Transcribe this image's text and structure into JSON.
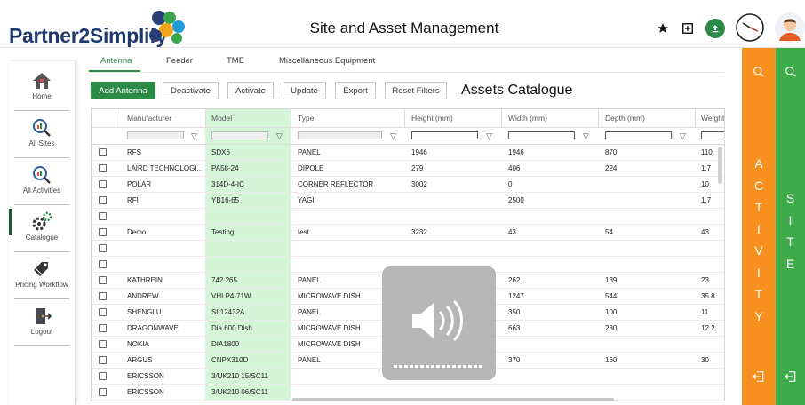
{
  "app": {
    "logo_text": "Partner2Simplify",
    "title": "Site and Asset Management"
  },
  "header_icons": [
    "star-icon",
    "add-box-icon",
    "upload-icon",
    "clock-icon",
    "user-avatar"
  ],
  "colors": {
    "primary_green": "#2b8a46",
    "activity_orange": "#f7901e",
    "site_green": "#3dab4a",
    "model_column_bg": "#d5f5d8"
  },
  "sidebar": {
    "items": [
      {
        "label": "Home",
        "icon": "home-icon"
      },
      {
        "label": "All Sites",
        "icon": "sites-search-icon"
      },
      {
        "label": "All Activities",
        "icon": "activities-search-icon"
      },
      {
        "label": "Catalogue",
        "icon": "gears-icon",
        "active": true
      },
      {
        "label": "Pricing Workflow",
        "icon": "price-tags-icon"
      },
      {
        "label": "Logout",
        "icon": "logout-door-icon"
      }
    ]
  },
  "tabs": [
    {
      "label": "Antenna",
      "active": true
    },
    {
      "label": "Feeder"
    },
    {
      "label": "TME"
    },
    {
      "label": "Miscellaneous Equipment"
    }
  ],
  "toolbar": {
    "add_label": "Add Antenna",
    "deactivate_label": "Deactivate",
    "activate_label": "Activate",
    "update_label": "Update",
    "export_label": "Export",
    "reset_label": "Reset Filters",
    "catalogue_title": "Assets Catalogue"
  },
  "table": {
    "columns": [
      "Manufacturer",
      "Model",
      "Type",
      "Height (mm)",
      "Width (mm)",
      "Depth (mm)",
      "Weight"
    ],
    "rows": [
      [
        "RFS",
        "SDX6",
        "PANEL",
        "1946",
        "1946",
        "870",
        "110."
      ],
      [
        "LAIRD TECHNOLOGI...",
        "PA58-24",
        "DIPOLE",
        "279",
        "406",
        "224",
        "1.7"
      ],
      [
        "POLAR",
        "314D-4-IC",
        "CORNER REFLECTOR",
        "3002",
        "0",
        "",
        "10"
      ],
      [
        "RFI",
        "YB16-65",
        "YAGI",
        "",
        "2500",
        "",
        "1.7"
      ],
      [
        "",
        "",
        "",
        "",
        "",
        "",
        ""
      ],
      [
        "Demo",
        "Testing",
        "test",
        "3232",
        "43",
        "54",
        "43"
      ],
      [
        "",
        "",
        "",
        "",
        "",
        "",
        ""
      ],
      [
        "",
        "",
        "",
        "",
        "",
        "",
        ""
      ],
      [
        "KATHREIN",
        "742 265",
        "PANEL",
        "",
        "262",
        "139",
        "23"
      ],
      [
        "ANDREW",
        "VHLP4-71W",
        "MICROWAVE DISH",
        "",
        "1247",
        "544",
        "35.8"
      ],
      [
        "SHENGLU",
        "SL12432A",
        "PANEL",
        "",
        "350",
        "100",
        "11"
      ],
      [
        "DRAGONWAVE",
        "Dia 600 Dish",
        "MICROWAVE DISH",
        "",
        "663",
        "230",
        "12.2"
      ],
      [
        "NOKIA",
        "DIA1800",
        "MICROWAVE DISH",
        "",
        "",
        "",
        ""
      ],
      [
        "ARGUS",
        "CNPX310D",
        "PANEL",
        "",
        "370",
        "160",
        "30"
      ],
      [
        "ERICSSON",
        "3/UK210 15/SC11",
        "",
        "",
        "",
        "",
        ""
      ],
      [
        "ERICSSON",
        "3/UK210 06/SC11",
        "",
        "",
        "",
        "",
        ""
      ]
    ]
  },
  "right_panels": {
    "activity_label": "ACTIVITY",
    "site_label": "SITE"
  },
  "overlay": {
    "icon": "speaker-volume-icon",
    "volume_level": 1.0
  }
}
